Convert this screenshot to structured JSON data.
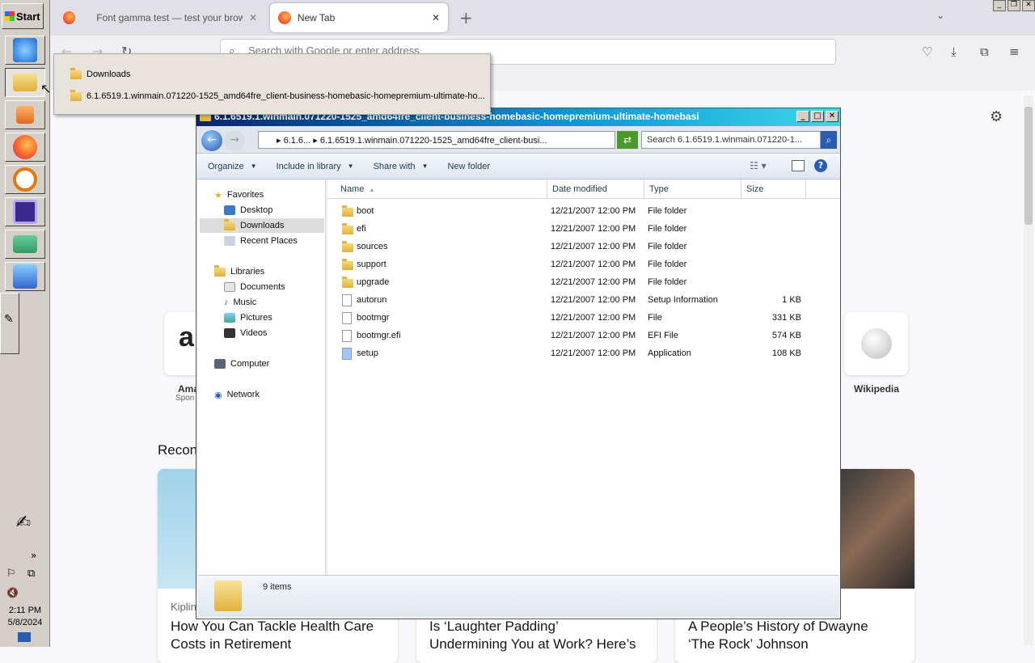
{
  "taskbar": {
    "start_label": "Start",
    "clock_time": "2:11 PM",
    "clock_date": "5/8/2024",
    "overflow_label": "»"
  },
  "browser": {
    "tabs": [
      {
        "label": "Font gamma test — test your browser"
      },
      {
        "label": "New Tab"
      }
    ],
    "url_placeholder": "Search with Google or enter address",
    "new_tab_plus": "+",
    "shortcuts": [
      {
        "label": "Ama",
        "sublabel": "Spon"
      },
      {
        "label": "Wikipedia"
      }
    ],
    "recommended_heading": "Recon",
    "stories": [
      {
        "source": "Kiplin",
        "title_line1": "How You Can Tackle Health Care",
        "title_line2": "Costs in Retirement"
      },
      {
        "title_line1": "Is ‘Laughter Padding’",
        "title_line2": "Undermining You at Work? Here’s"
      },
      {
        "title_line1": "A People’s History of Dwayne",
        "title_line2": "‘The Rock’ Johnson"
      }
    ]
  },
  "jumplist": {
    "items": [
      {
        "label": "Downloads"
      },
      {
        "label": "6.1.6519.1.winmain.071220-1525_amd64fre_client-business-homebasic-homepremium-ultimate-ho..."
      }
    ]
  },
  "explorer": {
    "title": "6.1.6519.1.winmain.071220-1525_amd64fre_client-business-homebasic-homepremium-ultimate-homebasi",
    "address": "▸ 6.1.6... ▸ 6.1.6519.1.winmain.071220-1525_amd64fre_client-busi...",
    "search_placeholder": "Search 6.1.6519.1.winmain.071220-1...",
    "commands": {
      "organize": "Organize",
      "include": "Include in library",
      "share": "Share with",
      "new_folder": "New folder"
    },
    "nav": {
      "favorites": "Favorites",
      "desktop": "Desktop",
      "downloads": "Downloads",
      "recent": "Recent Places",
      "libraries": "Libraries",
      "documents": "Documents",
      "music": "Music",
      "pictures": "Pictures",
      "videos": "Videos",
      "computer": "Computer",
      "network": "Network"
    },
    "columns": {
      "name": "Name",
      "date": "Date modified",
      "type": "Type",
      "size": "Size"
    },
    "files": [
      {
        "name": "boot",
        "date": "12/21/2007 12:00 PM",
        "type": "File folder",
        "size": ""
      },
      {
        "name": "efi",
        "date": "12/21/2007 12:00 PM",
        "type": "File folder",
        "size": ""
      },
      {
        "name": "sources",
        "date": "12/21/2007 12:00 PM",
        "type": "File folder",
        "size": ""
      },
      {
        "name": "support",
        "date": "12/21/2007 12:00 PM",
        "type": "File folder",
        "size": ""
      },
      {
        "name": "upgrade",
        "date": "12/21/2007 12:00 PM",
        "type": "File folder",
        "size": ""
      },
      {
        "name": "autorun",
        "date": "12/21/2007 12:00 PM",
        "type": "Setup Information",
        "size": "1 KB"
      },
      {
        "name": "bootmgr",
        "date": "12/21/2007 12:00 PM",
        "type": "File",
        "size": "331 KB"
      },
      {
        "name": "bootmgr.efi",
        "date": "12/21/2007 12:00 PM",
        "type": "EFI File",
        "size": "574 KB"
      },
      {
        "name": "setup",
        "date": "12/21/2007 12:00 PM",
        "type": "Application",
        "size": "108 KB"
      }
    ],
    "status_count": "9 items"
  }
}
